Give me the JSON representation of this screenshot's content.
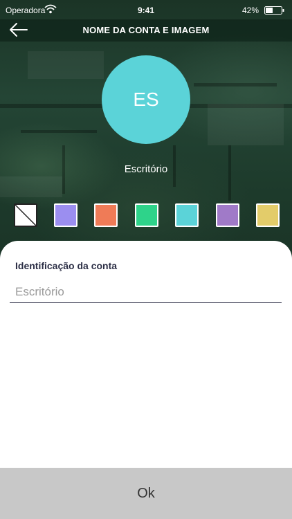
{
  "status_bar": {
    "carrier": "Operadora",
    "time": "9:41",
    "battery": "42%"
  },
  "nav": {
    "title": "NOME DA CONTA E IMAGEM",
    "back_icon": "arrow-left-icon"
  },
  "avatar": {
    "initials": "ES",
    "color": "#5bd3d8",
    "account_name": "Escritório"
  },
  "colors": [
    {
      "name": "none",
      "value": ""
    },
    {
      "name": "lavender",
      "value": "#9b8ef0"
    },
    {
      "name": "orange",
      "value": "#ef7b57"
    },
    {
      "name": "green",
      "value": "#2ed38a"
    },
    {
      "name": "cyan",
      "value": "#5bd3d8"
    },
    {
      "name": "purple",
      "value": "#a07ac8"
    },
    {
      "name": "yellow",
      "value": "#e3cc6a"
    }
  ],
  "form": {
    "label": "Identificação da conta",
    "placeholder": "Escritório",
    "value": ""
  },
  "ok_label": "Ok"
}
